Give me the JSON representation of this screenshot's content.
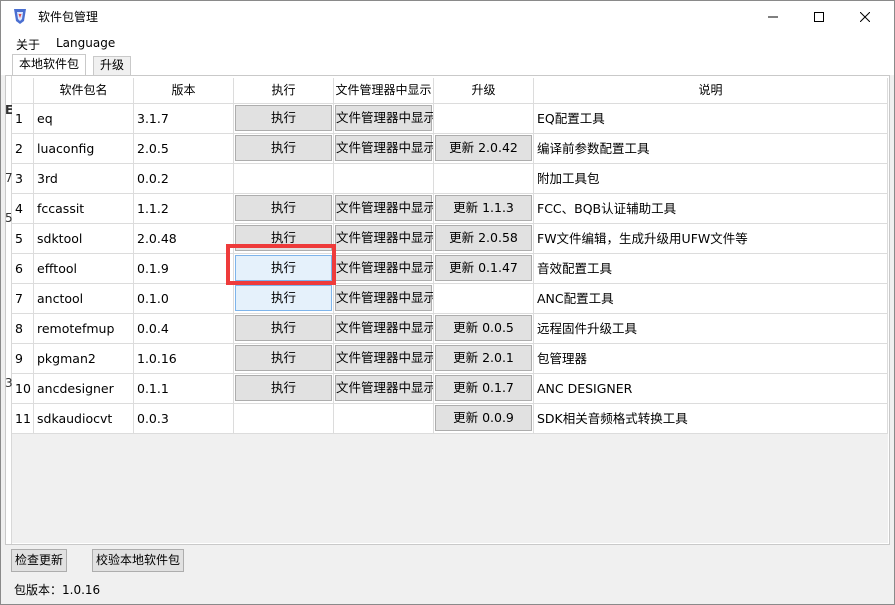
{
  "window": {
    "title": "软件包管理"
  },
  "menu": {
    "items": [
      "关于",
      "Language"
    ]
  },
  "tabs": [
    "本地软件包",
    "升级"
  ],
  "table": {
    "headers": [
      "软件包名",
      "版本",
      "执行",
      "文件管理器中显示",
      "升级",
      "说明"
    ],
    "rows": [
      {
        "num": "1",
        "name": "eq",
        "version": "3.1.7",
        "exec": "执行",
        "explorer": "文件管理器中显示",
        "upgrade": "",
        "desc": "EQ配置工具"
      },
      {
        "num": "2",
        "name": "luaconfig",
        "version": "2.0.5",
        "exec": "执行",
        "explorer": "文件管理器中显示",
        "upgrade": "更新 2.0.42",
        "desc": "编译前参数配置工具"
      },
      {
        "num": "3",
        "name": "3rd",
        "version": "0.0.2",
        "exec": "",
        "explorer": "",
        "upgrade": "",
        "desc": "附加工具包"
      },
      {
        "num": "4",
        "name": "fccassit",
        "version": "1.1.2",
        "exec": "执行",
        "explorer": "文件管理器中显示",
        "upgrade": "更新 1.1.3",
        "desc": "FCC、BQB认证辅助工具"
      },
      {
        "num": "5",
        "name": "sdktool",
        "version": "2.0.48",
        "exec": "执行",
        "explorer": "文件管理器中显示",
        "upgrade": "更新 2.0.58",
        "desc": "FW文件编辑，生成升级用UFW文件等"
      },
      {
        "num": "6",
        "name": "efftool",
        "version": "0.1.9",
        "exec": "执行",
        "explorer": "文件管理器中显示",
        "upgrade": "更新 0.1.47",
        "desc": "音效配置工具"
      },
      {
        "num": "7",
        "name": "anctool",
        "version": "0.1.0",
        "exec": "执行",
        "explorer": "文件管理器中显示",
        "upgrade": "",
        "desc": "ANC配置工具"
      },
      {
        "num": "8",
        "name": "remotefmup",
        "version": "0.0.4",
        "exec": "执行",
        "explorer": "文件管理器中显示",
        "upgrade": "更新 0.0.5",
        "desc": "远程固件升级工具"
      },
      {
        "num": "9",
        "name": "pkgman2",
        "version": "1.0.16",
        "exec": "执行",
        "explorer": "文件管理器中显示",
        "upgrade": "更新 2.0.1",
        "desc": "包管理器"
      },
      {
        "num": "10",
        "name": "ancdesigner",
        "version": "0.1.1",
        "exec": "执行",
        "explorer": "文件管理器中显示",
        "upgrade": "更新 0.1.7",
        "desc": "ANC DESIGNER"
      },
      {
        "num": "11",
        "name": "sdkaudiocvt",
        "version": "0.0.3",
        "exec": "",
        "explorer": "",
        "upgrade": "更新 0.0.9",
        "desc": "SDK相关音频格式转换工具"
      }
    ]
  },
  "buttons": {
    "check_update": "检查更新",
    "verify_local": "校验本地软件包"
  },
  "status": {
    "text": "包版本：1.0.16"
  },
  "left_strip": [
    "E",
    "7",
    "5",
    "3"
  ],
  "colors": {
    "highlight": "#ee3b3b",
    "button_face": "#e1e1e1",
    "focus_button": "#e5f1fb"
  }
}
